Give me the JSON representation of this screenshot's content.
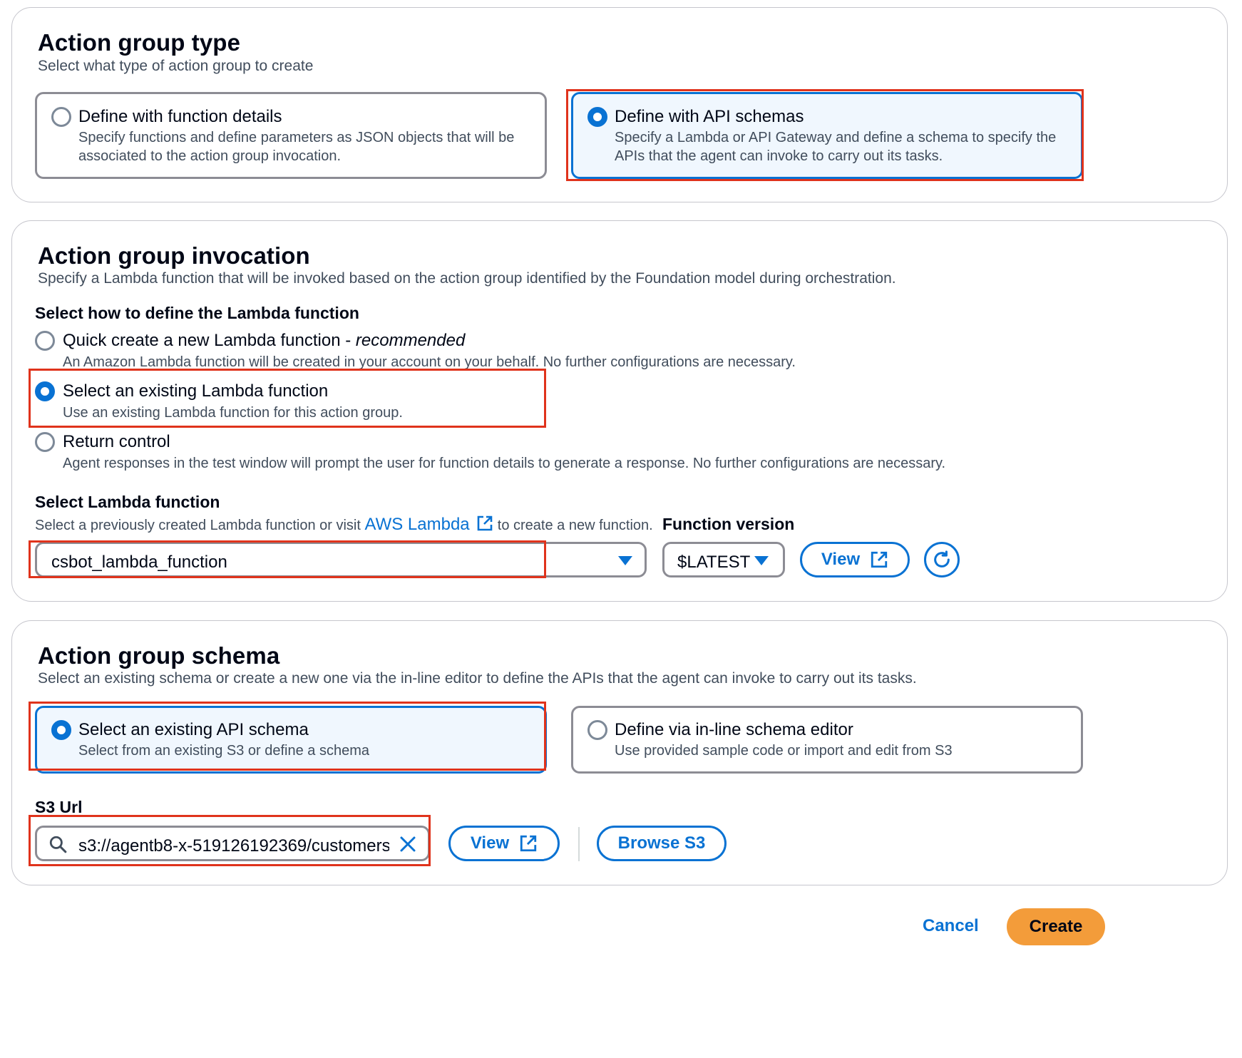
{
  "type_panel": {
    "title": "Action group type",
    "description": "Select what type of action group to create",
    "options": [
      {
        "title": "Define with function details",
        "desc_line1": "Specify functions and define parameters as JSON objects that will be",
        "desc_line2": "associated to the action group invocation.",
        "selected": false
      },
      {
        "title": "Define with API schemas",
        "desc_line1": "Specify a Lambda or API Gateway and define a schema to specify the",
        "desc_line2": "APIs that the agent can invoke to carry out its tasks.",
        "selected": true
      }
    ]
  },
  "invocation_panel": {
    "title": "Action group invocation",
    "description": "Specify a Lambda function that will be invoked based on the action group identified by the Foundation model during orchestration.",
    "define_label": "Select how to define the Lambda function",
    "options": [
      {
        "title": "Quick create a new Lambda function - ",
        "title_em": "recommended",
        "desc": "An Amazon Lambda function will be created in your account on your behalf. No further configurations are necessary.",
        "selected": false
      },
      {
        "title": "Select an existing Lambda function",
        "desc": "Use an existing Lambda function for this action group.",
        "selected": true
      },
      {
        "title": "Return control",
        "desc": "Agent responses in the test window will prompt the user for function details to generate a response. No further configurations are necessary.",
        "selected": false
      }
    ],
    "lambda_label": "Select Lambda function",
    "lambda_hint_before": "Select a previously created Lambda function or visit ",
    "lambda_hint_link": "AWS Lambda",
    "lambda_hint_after": " to create a new function.",
    "lambda_value": "csbot_lambda_function",
    "version_label": "Function version",
    "version_value": "$LATEST",
    "view_label": "View"
  },
  "schema_panel": {
    "title": "Action group schema",
    "description": "Select an existing schema or create a new one via the in-line editor to define the APIs that the agent can invoke to carry out its tasks.",
    "options": [
      {
        "title": "Select an existing API schema",
        "desc": "Select from an existing S3 or define a schema",
        "selected": true
      },
      {
        "title": "Define via in-line schema editor",
        "desc": "Use provided sample code or import and edit from S3",
        "selected": false
      }
    ],
    "s3_label": "S3 Url",
    "s3_value": "s3://agentb8-x-519126192369/customers",
    "view_label": "View",
    "browse_label": "Browse S3"
  },
  "footer": {
    "cancel_label": "Cancel",
    "create_label": "Create"
  },
  "colors": {
    "accent": "#0972d3",
    "highlight": "#e0331c",
    "create_button": "#f39c3a"
  }
}
